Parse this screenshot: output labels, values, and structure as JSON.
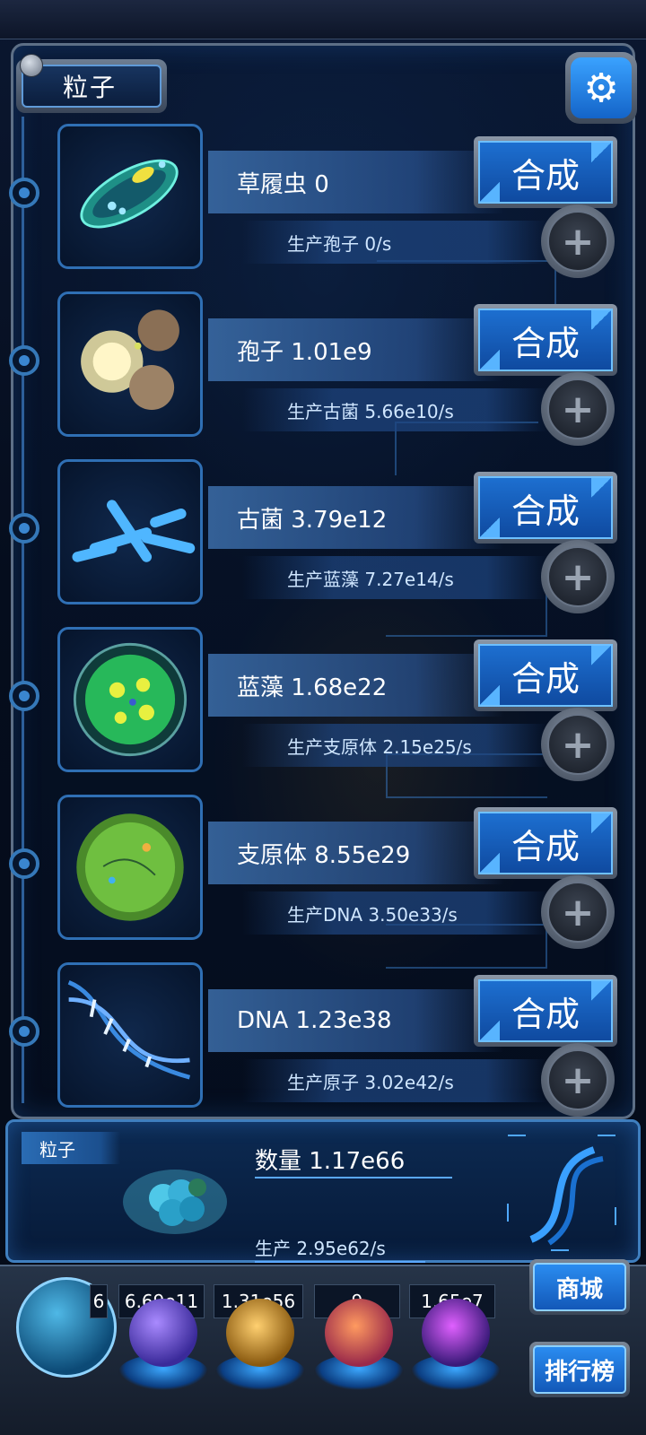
{
  "header": {
    "tab_title": "粒子",
    "settings_icon": "gear-icon"
  },
  "rows": [
    {
      "icon": "paramecium-icon",
      "name": "草履虫 0",
      "production": "生产孢子 0/s",
      "synth_label": "合成",
      "plus_icon": "plus-icon"
    },
    {
      "icon": "spore-icon",
      "name": "孢子 1.01e9",
      "production": "生产古菌 5.66e10/s",
      "synth_label": "合成",
      "plus_icon": "plus-icon"
    },
    {
      "icon": "archaea-icon",
      "name": "古菌 3.79e12",
      "production": "生产蓝藻 7.27e14/s",
      "synth_label": "合成",
      "plus_icon": "plus-icon"
    },
    {
      "icon": "cyanobacteria-icon",
      "name": "蓝藻 1.68e22",
      "production": "生产支原体 2.15e25/s",
      "synth_label": "合成",
      "plus_icon": "plus-icon"
    },
    {
      "icon": "mycoplasma-icon",
      "name": "支原体 8.55e29",
      "production": "生产DNA 3.50e33/s",
      "synth_label": "合成",
      "plus_icon": "plus-icon"
    },
    {
      "icon": "dna-icon",
      "name": "DNA 1.23e38",
      "production": "生产原子 3.02e42/s",
      "synth_label": "合成",
      "plus_icon": "plus-icon"
    }
  ],
  "particle_panel": {
    "tag": "粒子",
    "count": "数量 1.17e66",
    "production": "生产 2.95e62/s",
    "icon": "particle-cluster-icon",
    "dna_icon": "dna-helix-icon"
  },
  "bottom_bar": {
    "stats": [
      "6",
      "6.69e11",
      "1.31e56",
      "9",
      "1.65e7"
    ],
    "orbs": [
      "particle-orb-icon",
      "lightning-orb-icon",
      "nebula-orb-icon",
      "brain-orb-icon",
      "vortex-orb-icon"
    ],
    "shop_label": "商城",
    "ranking_label": "排行榜"
  }
}
